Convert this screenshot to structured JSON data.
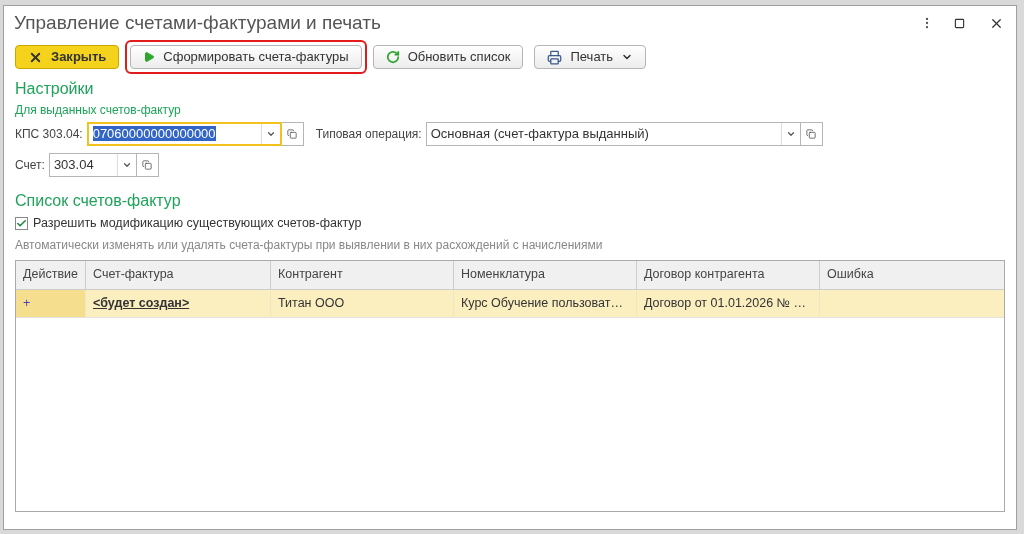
{
  "window": {
    "title": "Управление счетами-фактурами и печать"
  },
  "toolbar": [
    {
      "kind": "close",
      "label": "Закрыть",
      "highlighted": false
    },
    {
      "kind": "run",
      "label": "Сформировать счета-фактуры",
      "highlighted": true
    },
    {
      "kind": "refresh",
      "label": "Обновить список",
      "highlighted": false
    },
    {
      "kind": "print",
      "label": "Печать",
      "highlighted": false
    }
  ],
  "settings": {
    "title": "Настройки",
    "subtitle": "Для выданных счетов-фактур",
    "kps": {
      "label": "КПС 303.04:",
      "value": "07060000000000000",
      "focused": true
    },
    "operation": {
      "label": "Типовая операция:",
      "value": "Основная (счет-фактура выданный)"
    },
    "account": {
      "label": "Счет:",
      "value": "303.04"
    }
  },
  "invoices": {
    "title": "Список счетов-фактур",
    "allow_modify": {
      "label": "Разрешить модификацию существующих счетов-фактур",
      "checked": true
    },
    "hint": "Автоматически изменять или удалять счета-фактуры при выявлении в них расхождений с начислениями"
  },
  "table": {
    "columns": [
      "Действие",
      "Счет-фактура",
      "Контрагент",
      "Номенклатура",
      "Договор контрагента",
      "Ошибка"
    ],
    "rows": [
      {
        "selected": true,
        "cells": [
          "+",
          "<будет создан>",
          "Титан ООО",
          "Курс Обучение пользоват…",
          "Договор от 01.01.2026 № …",
          ""
        ]
      }
    ]
  }
}
